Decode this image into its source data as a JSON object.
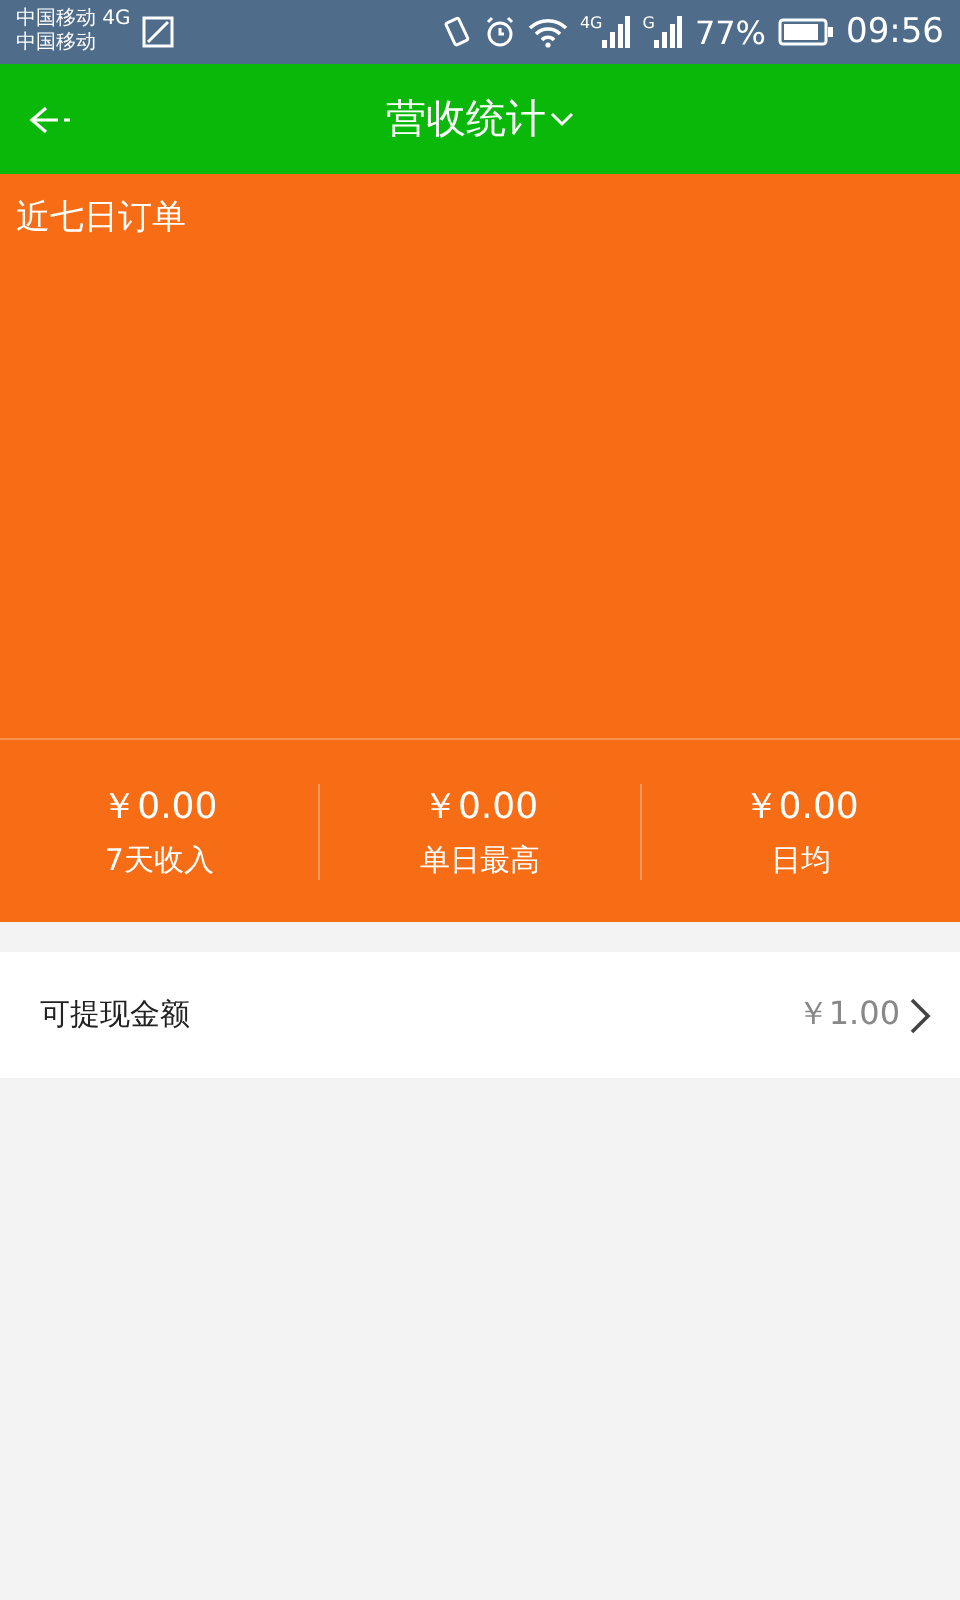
{
  "status_bar": {
    "carrier_lines": [
      "中国移动 4G",
      "中国移动"
    ],
    "signal_labels": [
      "4G",
      "G"
    ],
    "battery": "77%",
    "time": "09:56"
  },
  "header": {
    "title": "营收统计"
  },
  "chart_panel": {
    "title": "近七日订单"
  },
  "stats": [
    {
      "value": "￥0.00",
      "label": "7天收入"
    },
    {
      "value": "￥0.00",
      "label": "单日最高"
    },
    {
      "value": "￥0.00",
      "label": "日均"
    }
  ],
  "withdraw_row": {
    "label": "可提现金额",
    "amount": "￥1.00"
  }
}
